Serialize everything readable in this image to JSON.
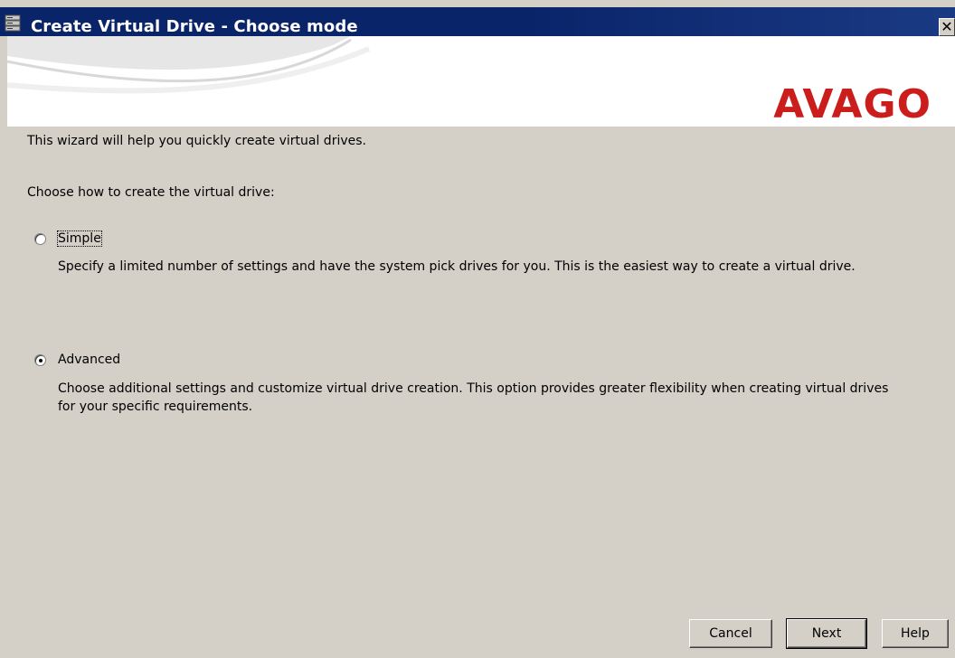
{
  "window": {
    "title": "Create Virtual Drive - Choose mode",
    "close_label": "✕"
  },
  "banner": {
    "logo_text": "AVAGO",
    "logo_color": "#cc1d1d"
  },
  "wizard": {
    "intro": "This wizard will help you quickly create virtual drives.",
    "prompt": "Choose how to create the virtual drive:",
    "options": [
      {
        "label": "Simple",
        "selected": false,
        "description": "Specify a limited number of settings and have the system pick drives for you. This is the easiest way to create a virtual drive."
      },
      {
        "label": "Advanced",
        "selected": true,
        "description": "Choose additional settings and customize virtual drive creation. This option provides greater flexibility when creating virtual drives for your specific requirements."
      }
    ]
  },
  "buttons": {
    "cancel": "Cancel",
    "next": "Next",
    "help": "Help"
  },
  "colors": {
    "titlebar": "#0a246a",
    "dialog_bg": "#d4d0c8",
    "banner_bg": "#ffffff"
  }
}
